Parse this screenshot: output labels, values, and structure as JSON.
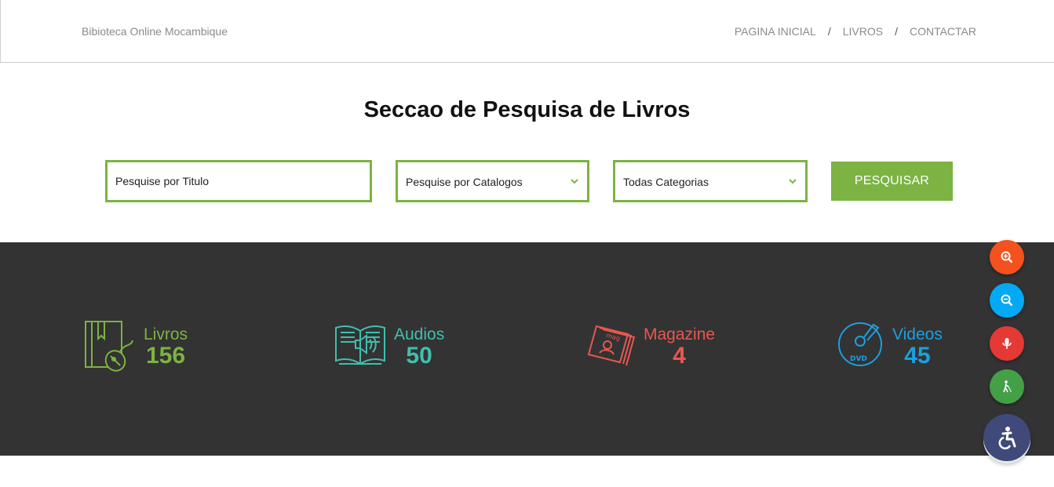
{
  "header": {
    "brand": "Bibioteca Online Mocambique",
    "nav": [
      "PAGINA INICIAL",
      "LIVROS",
      "CONTACTAR"
    ],
    "separator": "/"
  },
  "search": {
    "title": "Seccao de Pesquisa de Livros",
    "title_placeholder": "Pesquise por Titulo",
    "catalog_select": "Pesquise por Catalogos",
    "category_select": "Todas Categorias",
    "button": "PESQUISAR"
  },
  "stats": [
    {
      "label": "Livros",
      "count": "156",
      "color": "#7cb342",
      "icon": "book-mouse-icon"
    },
    {
      "label": "Audios",
      "count": "50",
      "color": "#3fbfae",
      "icon": "audio-book-icon"
    },
    {
      "label": "Magazine",
      "count": "4",
      "color": "#e9574f",
      "icon": "magazine-icon"
    },
    {
      "label": "Videos",
      "count": "45",
      "color": "#1aa0e0",
      "icon": "dvd-icon"
    }
  ],
  "dvd_text": "DVD",
  "accessibility": {
    "buttons": [
      {
        "icon": "zoom-in-icon",
        "color": "#f4511e"
      },
      {
        "icon": "zoom-out-icon",
        "color": "#03a9f4"
      },
      {
        "icon": "microphone-icon",
        "color": "#e53935"
      },
      {
        "icon": "walking-cane-icon",
        "color": "#43a047"
      }
    ],
    "main_icon": "accessibility-icon",
    "main_color": "#3f4a7a"
  },
  "colors": {
    "accent": "#7cb342",
    "band": "#333333"
  }
}
